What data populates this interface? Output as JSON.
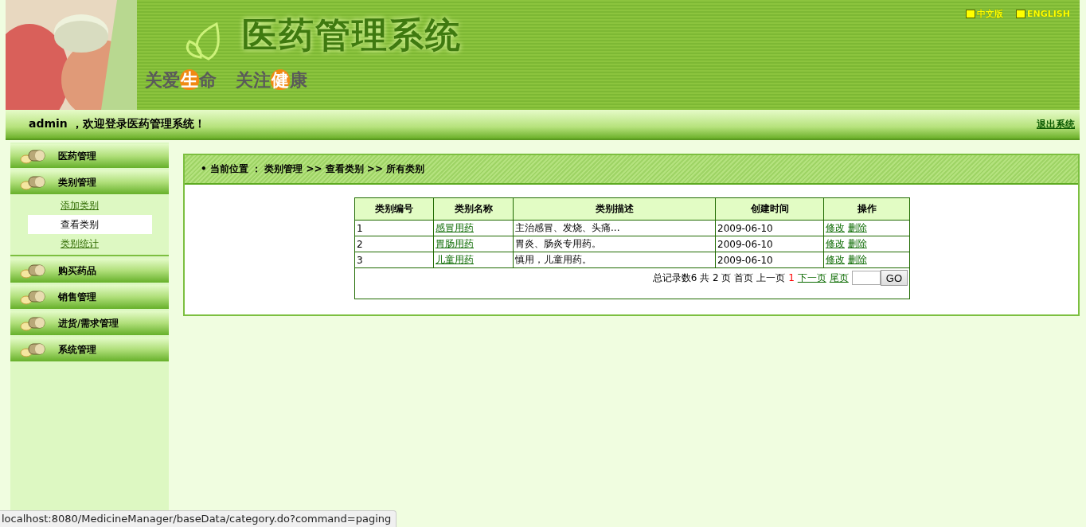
{
  "header": {
    "title": "医药管理系统",
    "slogan": [
      {
        "text": "关爱",
        "highlight": false
      },
      {
        "text": "生",
        "highlight": true
      },
      {
        "text": "命",
        "highlight": false
      },
      {
        "text": "关注",
        "highlight": false
      },
      {
        "text": "健",
        "highlight": true
      },
      {
        "text": "康",
        "highlight": false
      }
    ],
    "languages": [
      "中文版",
      "ENGLISH"
    ]
  },
  "welcome_bar": {
    "message": "admin ，欢迎登录医药管理系统！",
    "logout": "退出系统"
  },
  "sidebar": {
    "menus": [
      {
        "label": "医药管理"
      },
      {
        "label": "类别管理",
        "children": [
          {
            "label": "添加类别",
            "selected": false
          },
          {
            "label": "查看类别",
            "selected": true
          },
          {
            "label": "类别统计",
            "selected": false
          }
        ]
      },
      {
        "label": "购买药品"
      },
      {
        "label": "销售管理"
      },
      {
        "label": "进货/需求管理"
      },
      {
        "label": "系统管理"
      }
    ]
  },
  "breadcrumb": "• 当前位置 ： 类别管理 >> 查看类别 >> 所有类别",
  "table": {
    "columns": [
      "类别编号",
      "类别名称",
      "类别描述",
      "创建时间",
      "操作"
    ],
    "rows": [
      {
        "id": "1",
        "name": "感冒用药",
        "description": "主治感冒、发烧、头痛...",
        "created": "2009-06-10",
        "actions": [
          "修改",
          "删除"
        ]
      },
      {
        "id": "2",
        "name": "胃肠用药",
        "description": "胃炎、肠炎专用药。",
        "created": "2009-06-10",
        "actions": [
          "修改",
          "删除"
        ]
      },
      {
        "id": "3",
        "name": "儿童用药",
        "description": "慎用，儿童用药。",
        "created": "2009-06-10",
        "actions": [
          "修改",
          "删除"
        ]
      }
    ]
  },
  "pager": {
    "items": [
      {
        "kind": "text",
        "text": "总记录数6 共 2 页 首页 上一页"
      },
      {
        "kind": "current",
        "text": "1"
      },
      {
        "kind": "link",
        "text": "下一页"
      },
      {
        "kind": "link",
        "text": "尾页"
      }
    ],
    "go_button": "GO"
  },
  "status_url": "localhost:8080/MedicineManager/baseData/category.do?command=paging"
}
